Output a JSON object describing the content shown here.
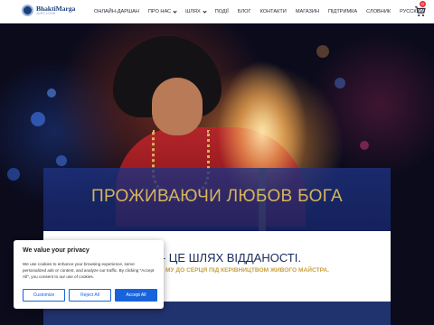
{
  "header": {
    "logo_name": "BhaktiMarga",
    "logo_tag": "JUST LOVE",
    "nav": [
      {
        "label": "ОНЛАЙН-ДАРШАН",
        "has_dropdown": false
      },
      {
        "label": "ПРО НАС",
        "has_dropdown": true
      },
      {
        "label": "ШЛЯХ",
        "has_dropdown": true
      },
      {
        "label": "ПОДІЇ",
        "has_dropdown": false
      },
      {
        "label": "БЛОГ",
        "has_dropdown": false
      },
      {
        "label": "КОНТАКТИ",
        "has_dropdown": false
      },
      {
        "label": "МАГАЗИН",
        "has_dropdown": false
      },
      {
        "label": "ПІДТРИМКА",
        "has_dropdown": false
      },
      {
        "label": "СЛОВНИК",
        "has_dropdown": false
      },
      {
        "label": "РУССКИЙ",
        "has_dropdown": false
      }
    ],
    "cart_icon": "cart-icon",
    "cart_count": "0"
  },
  "hero": {
    "title": "ПРОЖИВАЮЧИ ЛЮБОВ БОГА",
    "subtitle": "АРГА - ЦЕ ШЛЯХ ВІДДАНОСТІ.",
    "tagline": "МУ ДО СЕРЦЯ ПІД КЕРІВНИЦТВОМ ЖИВОГО МАЙСТРА."
  },
  "cookie": {
    "title": "We value your privacy",
    "text": "We use cookies to enhance your browsing experience, serve personalized ads or content, and analyze our traffic. By clicking \"Accept All\", you consent to our use of cookies.",
    "customize": "Customize",
    "reject": "Reject All",
    "accept": "Accept All"
  },
  "colors": {
    "brand": "#1a3f7a",
    "gold": "#d6b45e",
    "accept": "#1863dc"
  }
}
